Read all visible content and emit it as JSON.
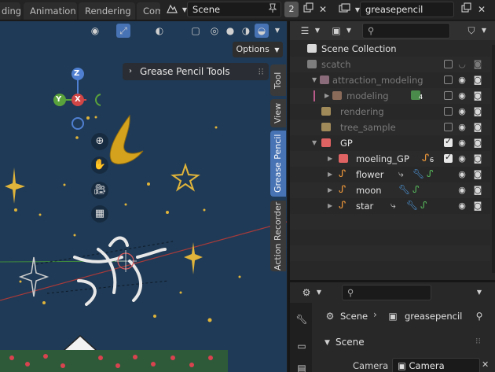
{
  "topbar": {
    "tabs": [
      "ding",
      "Animation",
      "Rendering",
      "Com"
    ],
    "scene_name": "Scene",
    "scene_count": "2",
    "view_layer": "greasepencil"
  },
  "viewport": {
    "options_label": "Options",
    "panel_title": "Grease Pencil Tools",
    "side_tabs": [
      "Tool",
      "View",
      "Grease Pencil",
      "Action Recorder"
    ],
    "gizmo_axes": [
      "Z",
      "Y",
      "X"
    ]
  },
  "outliner": {
    "search_placeholder": "",
    "root": "Scene Collection",
    "rows": [
      {
        "name": "scatch",
        "state": "dim"
      },
      {
        "name": "attraction_modeling",
        "state": "dim"
      },
      {
        "name": "modeling",
        "state": "dim",
        "badge": "4"
      },
      {
        "name": "rendering",
        "state": "dim"
      },
      {
        "name": "tree_sample",
        "state": "dim"
      },
      {
        "name": "GP",
        "state": "bright"
      },
      {
        "name": "moeling_GP",
        "state": "bright",
        "badge": "6"
      },
      {
        "name": "flower",
        "state": "bright"
      },
      {
        "name": "moon",
        "state": "bright"
      },
      {
        "name": "star",
        "state": "bright"
      }
    ]
  },
  "properties": {
    "breadcrumb_scene": "Scene",
    "breadcrumb_layer": "greasepencil",
    "section": "Scene",
    "camera_label": "Camera",
    "camera_value": "Camera"
  },
  "colors": {
    "viewport_bg": "#1f3a56",
    "accent": "#4772b3",
    "collection_red": "#e06363",
    "collection_tan": "#c9a96e",
    "gp_orange": "#e8943a",
    "modifier_blue": "#4f9be0",
    "modifier_green": "#56b35a"
  }
}
